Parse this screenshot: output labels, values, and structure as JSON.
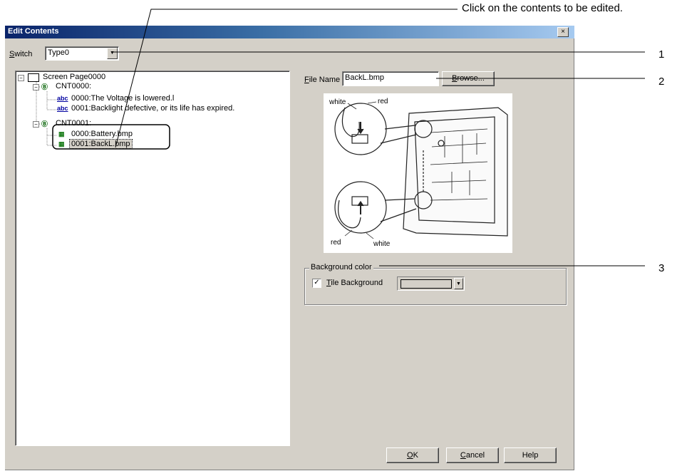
{
  "callouts": {
    "top": "Click on the contents to be edited.",
    "n1": "1",
    "n2": "2",
    "n3": "3"
  },
  "dialog": {
    "title": "Edit Contents",
    "close_glyph": "×"
  },
  "switch": {
    "label_accel": "S",
    "label_rest": "witch",
    "value": "Type0",
    "arrow": "▼"
  },
  "tree": {
    "expander_open": "−",
    "root": "Screen Page0000",
    "cnt0": "CNT0000:",
    "cnt0_item0": "0000:The Voltage is lowered.l",
    "cnt0_item1": "0001:Backlight defective, or its life has expired.",
    "cnt1": "CNT0001:",
    "cnt1_item0": "0000:Battery.bmp",
    "cnt1_item1": "0001:BackL.bmp",
    "abc_icon_text": "abc",
    "cnt_icon_text": "Ⓑ",
    "bmp_icon_text": "▦"
  },
  "file": {
    "label_accel": "F",
    "label_rest": "ile Name",
    "value": "BackL.bmp",
    "browse_accel": "B",
    "browse_rest": "rowse..."
  },
  "image": {
    "label_white_top": "white",
    "label_red_top": "red",
    "label_red_bottom": "red",
    "label_white_bottom": "white"
  },
  "background": {
    "group_title": "Background color",
    "checked_glyph": "✓",
    "tile_accel": "T",
    "tile_rest": "ile Background",
    "swatch_color": "#d4d0c8",
    "arrow": "▼"
  },
  "buttons": {
    "ok_accel": "O",
    "ok_rest": "K",
    "cancel_accel": "C",
    "cancel_rest": "ancel",
    "help": "Help"
  }
}
